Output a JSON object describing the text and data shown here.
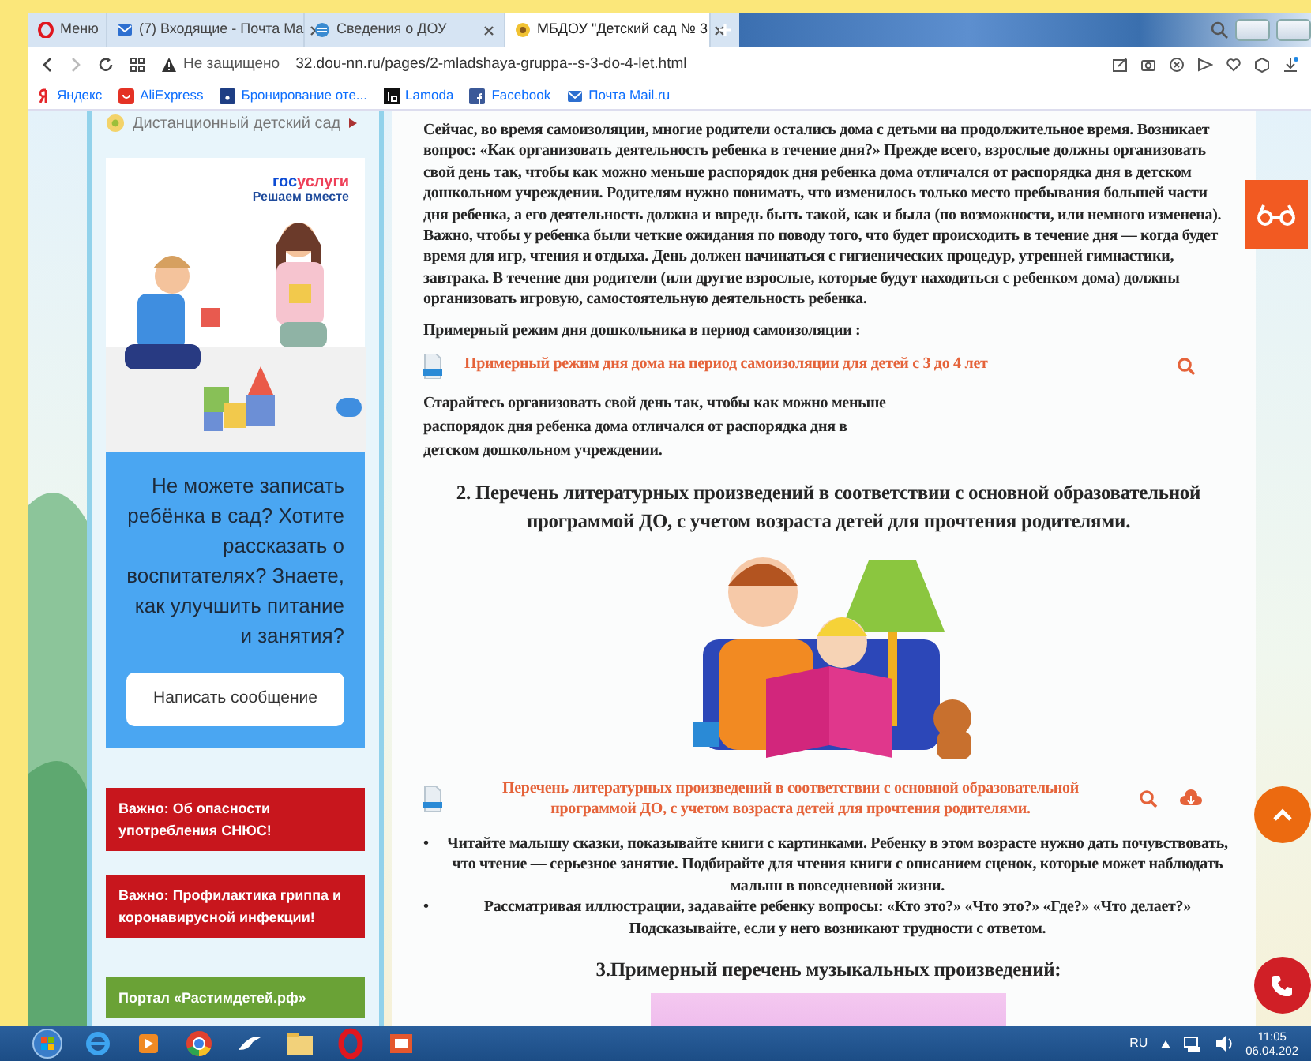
{
  "browser": {
    "tabs": [
      {
        "label": "Меню",
        "kind": "menu",
        "selected": false
      },
      {
        "label": "(7) Входящие - Почта Ma",
        "kind": "mail",
        "selected": false
      },
      {
        "label": "Сведения о ДОУ",
        "kind": "site",
        "selected": false
      },
      {
        "label": "МБДОУ \"Детский сад № 3",
        "kind": "flower",
        "selected": true
      }
    ],
    "security_label": "Не защищено",
    "url": "32.dou-nn.ru/pages/2-mladshaya-gruppa--s-3-do-4-let.html",
    "bookmarks": [
      {
        "label": "Яндекс",
        "kind": "yandex"
      },
      {
        "label": "AliExpress",
        "kind": "ali"
      },
      {
        "label": "Бронирование оте...",
        "kind": "booking"
      },
      {
        "label": "Lamoda",
        "kind": "lamoda"
      },
      {
        "label": "Facebook",
        "kind": "facebook"
      },
      {
        "label": "Почта Mail.ru",
        "kind": "mail"
      }
    ]
  },
  "sidebar": {
    "menu_item": "Дистанционный детский сад",
    "banner": {
      "logo_parts": [
        {
          "text": "гос",
          "color": "#0d4cd3"
        },
        {
          "text": "услуги",
          "color": "#ee3f58"
        }
      ],
      "tagline": "Решаем вместе",
      "question": "Не можете записать ребёнка в сад? Хотите рассказать о воспитателях? Знаете, как улучшить питание и занятия?",
      "button": "Написать сообщение"
    },
    "links": [
      {
        "label": "Важно: Об опасности употребления СНЮС!",
        "color": "#c8161d"
      },
      {
        "label": "Важно: Профилактика гриппа и коронавирусной инфекции!",
        "color": "#c8161d"
      },
      {
        "label": "Портал «Растимдетей.рф»",
        "color": "#6aa236"
      }
    ]
  },
  "main": {
    "blocks": [
      {
        "kind": "paragraph",
        "text": "Сейчас, во время самоизоляции, многие родители остались дома с детьми на продолжительное время. Возникает вопрос: «Как организовать деятельность ребенка в течение дня?» Прежде всего, взрослые должны организовать свой день так, чтобы как можно меньше распорядок дня ребенка дома отличался от распорядка дня в детском дошкольном учреждении. Родителям нужно понимать, что изменилось только место пребывания большей части дня ребенка, а его деятельность должна и впредь быть такой, как и была (по возможности, или немного изменена). Важно, чтобы у ребенка были четкие ожидания по поводу того, что будет происходить в течение дня — когда будет время для игр, чтения и отдыха. День должен начинаться с гигиенических процедур, утренней гимнастики, завтрака. В течение дня родители (или другие взрослые, которые будут находиться с ребенком дома) должны организовать игровую, самостоятельную деятельность ребенка."
      },
      {
        "kind": "paragraph",
        "text": "Примерный режим дня дошкольника в период самоизоляции :"
      },
      {
        "kind": "document",
        "title": "Примерный режим дня дома на период самоизоляции для детей с 3 до 4 лет",
        "download": false
      },
      {
        "kind": "note",
        "text": "Старайтесь организовать свой день так, чтобы как можно меньше распорядок дня ребенка дома отличался от распорядка дня в детском дошкольном учреждении."
      },
      {
        "kind": "heading",
        "text": "2. Перечень литературных произведений в соответствии с основной образовательной программой ДО, с учетом возраста детей для прочтения родителями."
      },
      {
        "kind": "illustration"
      },
      {
        "kind": "document",
        "title": "Перечень литературных произведений в соответствии с основной образовательной программой ДО, с учетом возраста детей для прочтения родителями.",
        "download": true
      },
      {
        "kind": "bullets",
        "items": [
          {
            "marker": "•",
            "text": "Читайте малышу сказки, показывайте книги с картинками. Ребенку в этом возрасте нужно дать почувствовать, что чтение — серьезное занятие. Подбирайте для чтения книги с описанием сценок, которые может наблюдать малыш в повседневной жизни."
          },
          {
            "marker": "•",
            "text": "Рассматривая иллюстрации, задавайте ребенку вопросы: «Кто это?» «Что это?» «Где?» «Что делает?» Подсказывайте, если у него возникают трудности с ответом."
          }
        ]
      },
      {
        "kind": "heading",
        "text": "3.Примерный перечень музыкальных произведений:"
      },
      {
        "kind": "illustration"
      }
    ]
  },
  "taskbar": {
    "language": "RU",
    "time": "11:05",
    "date": "06.04.202"
  }
}
